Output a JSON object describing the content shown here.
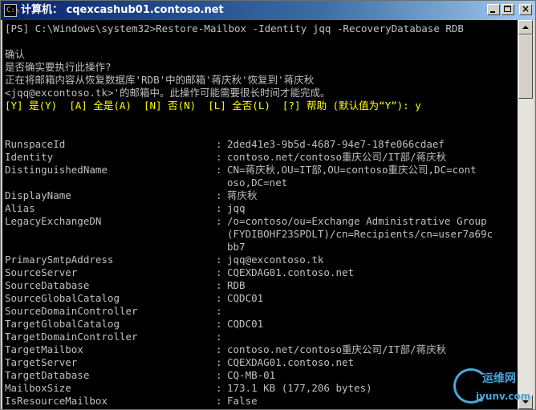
{
  "window": {
    "title": "计算机： cqexcashub01.contoso.net",
    "icon_glyph": "C:\\"
  },
  "console": {
    "command_line": "[PS] C:\\Windows\\system32>Restore-Mailbox -Identity jqq -RecoveryDatabase RDB",
    "confirm_title": "确认",
    "confirm_question": "是否确实要执行此操作?",
    "confirm_line1": "正在将邮箱内容从恢复数据库'RDB'中的邮箱'蒋庆秋'恢复到'蒋庆秋",
    "confirm_line2": "<jqq@excontoso.tk>'的邮箱中。此操作可能需要很长时间才能完成。",
    "choice_line": "[Y] 是(Y)  [A] 全是(A)  [N] 否(N)  [L] 全否(L)  [?] 帮助 (默认值为“Y”): y",
    "properties": [
      {
        "name": "RunspaceId",
        "value": "2ded41e3-9b5d-4687-94e7-18fe066cdaef"
      },
      {
        "name": "Identity",
        "value": "contoso.net/contoso重庆公司/IT部/蒋庆秋"
      },
      {
        "name": "DistinguishedName",
        "value": "CN=蒋庆秋,OU=IT部,OU=contoso重庆公司,DC=cont\noso,DC=net"
      },
      {
        "name": "DisplayName",
        "value": "蒋庆秋"
      },
      {
        "name": "Alias",
        "value": "jqq"
      },
      {
        "name": "LegacyExchangeDN",
        "value": "/o=contoso/ou=Exchange Administrative Group\n(FYDIBOHF23SPDLT)/cn=Recipients/cn=user7a69c\nbb7"
      },
      {
        "name": "PrimarySmtpAddress",
        "value": "jqq@excontoso.tk"
      },
      {
        "name": "SourceServer",
        "value": "CQEXDAG01.contoso.net"
      },
      {
        "name": "SourceDatabase",
        "value": "RDB"
      },
      {
        "name": "SourceGlobalCatalog",
        "value": "CQDC01"
      },
      {
        "name": "SourceDomainController",
        "value": ""
      },
      {
        "name": "TargetGlobalCatalog",
        "value": "CQDC01"
      },
      {
        "name": "TargetDomainController",
        "value": ""
      },
      {
        "name": "TargetMailbox",
        "value": "contoso.net/contoso重庆公司/IT部/蒋庆秋"
      },
      {
        "name": "TargetServer",
        "value": "CQEXDAG01.contoso.net"
      },
      {
        "name": "TargetDatabase",
        "value": "CQ-MB-01"
      },
      {
        "name": "MailboxSize",
        "value": "173.1 KB (177,206 bytes)"
      },
      {
        "name": "IsResourceMailbox",
        "value": "False"
      }
    ]
  },
  "watermark": {
    "line1": "运维网",
    "line2": "iyunv.com"
  },
  "colors": {
    "console_bg": "#000000",
    "console_text": "#c0c0c0",
    "prompt_text": "#ffff00",
    "titlebar": "#0a246a"
  }
}
